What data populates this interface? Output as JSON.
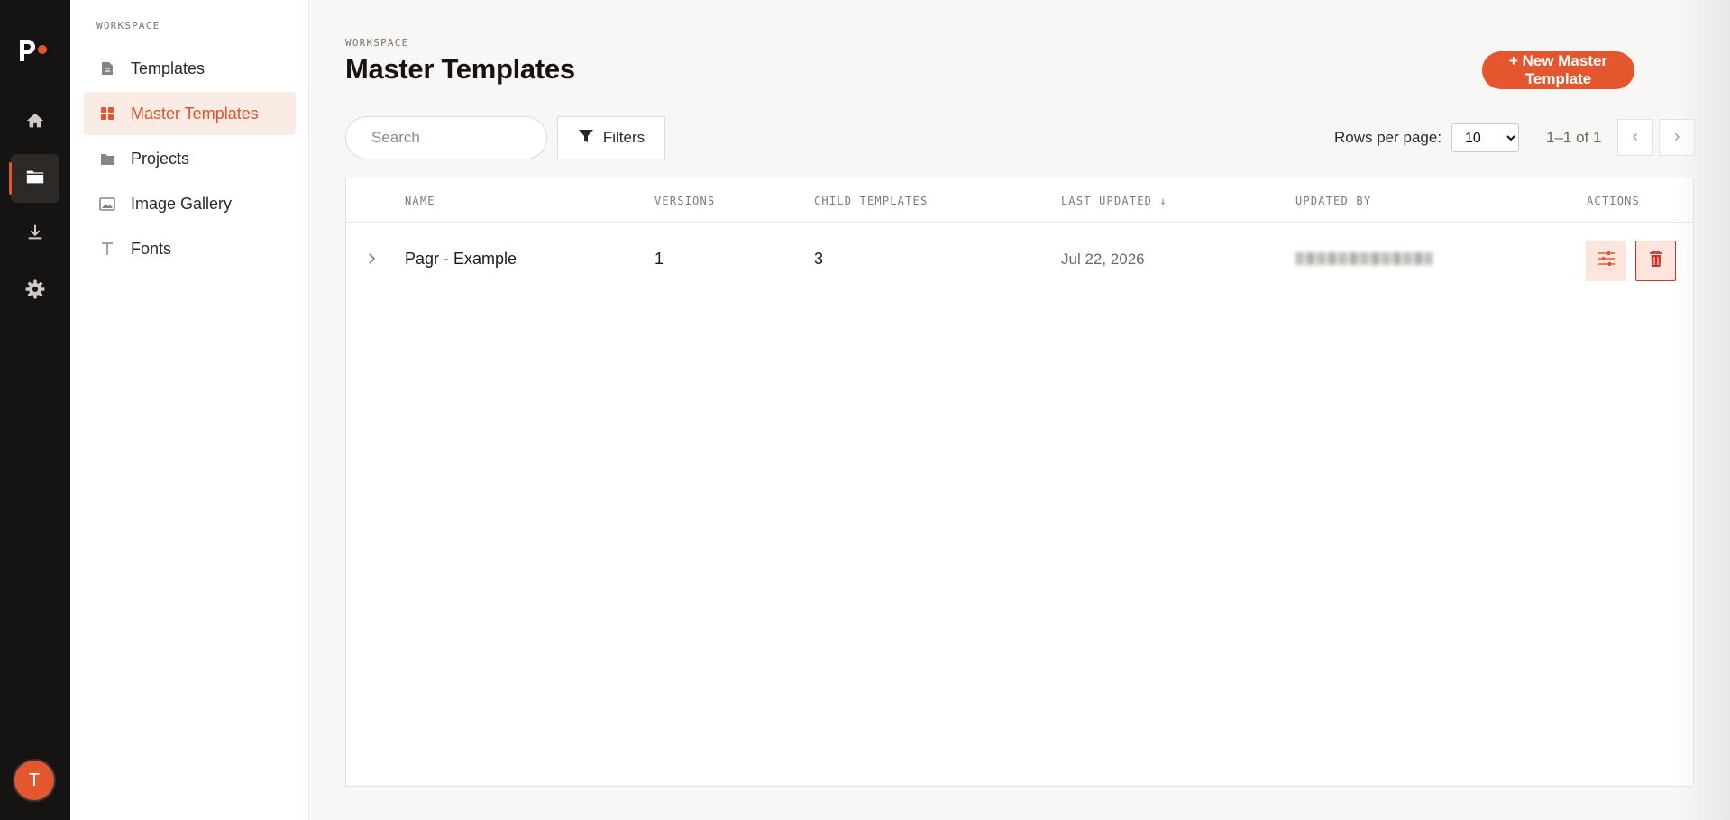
{
  "rail": {
    "items": [
      {
        "icon": "home-icon"
      },
      {
        "icon": "folder-icon",
        "active": true
      },
      {
        "icon": "download-icon"
      },
      {
        "icon": "gear-icon"
      }
    ],
    "avatar_initial": "T"
  },
  "sidebar": {
    "section_label": "WORKSPACE",
    "items": [
      {
        "label": "Templates",
        "icon": "document-icon"
      },
      {
        "label": "Master Templates",
        "icon": "grid-icon",
        "active": true
      },
      {
        "label": "Projects",
        "icon": "folder-icon"
      },
      {
        "label": "Image Gallery",
        "icon": "image-icon"
      },
      {
        "label": "Fonts",
        "icon": "text-icon"
      }
    ]
  },
  "header": {
    "eyebrow": "WORKSPACE",
    "title": "Master Templates",
    "new_button": "+ New Master Template"
  },
  "toolbar": {
    "search_placeholder": "Search",
    "filters_label": "Filters",
    "rows_per_page_label": "Rows per page:",
    "rows_per_page_value": "10",
    "rows_per_page_options": [
      "10"
    ],
    "range_text": "1–1 of 1"
  },
  "table": {
    "columns": [
      "NAME",
      "VERSIONS",
      "CHILD TEMPLATES",
      "LAST UPDATED ↓",
      "UPDATED BY",
      "ACTIONS"
    ],
    "rows": [
      {
        "name": "Pagr - Example",
        "versions": "1",
        "child_templates": "3",
        "last_updated": "Jul 22, 2026"
      }
    ]
  },
  "colors": {
    "accent": "#e4572e",
    "rail_bg": "#161412",
    "active_bg": "#fbebe5"
  }
}
